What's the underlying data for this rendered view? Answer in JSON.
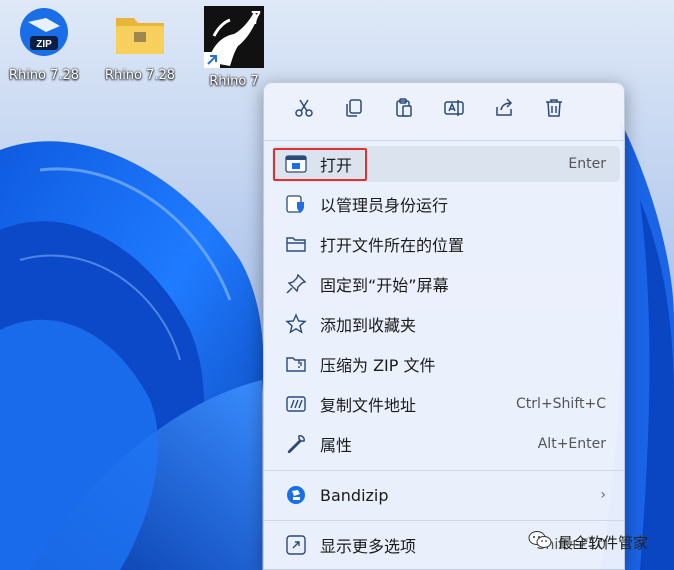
{
  "desktop": {
    "icons": [
      {
        "label": "Rhino 7.28",
        "icon": "zip-archive-icon"
      },
      {
        "label": "Rhino 7.28",
        "icon": "folder-icon"
      },
      {
        "label": "Rhino 7",
        "icon": "rhino-app-icon"
      }
    ]
  },
  "toolbar": {
    "items": [
      {
        "icon": "cut-icon"
      },
      {
        "icon": "copy-icon"
      },
      {
        "icon": "paste-icon"
      },
      {
        "icon": "rename-icon"
      },
      {
        "icon": "share-icon"
      },
      {
        "icon": "delete-icon"
      }
    ]
  },
  "menu": {
    "items": [
      {
        "label": "打开",
        "shortcut": "Enter",
        "icon": "open-window-icon"
      },
      {
        "label": "以管理员身份运行",
        "shortcut": "",
        "icon": "shield-icon"
      },
      {
        "label": "打开文件所在的位置",
        "shortcut": "",
        "icon": "folder-outline-icon"
      },
      {
        "label": "固定到“开始”屏幕",
        "shortcut": "",
        "icon": "pin-icon"
      },
      {
        "label": "添加到收藏夹",
        "shortcut": "",
        "icon": "star-icon"
      },
      {
        "label": "压缩为 ZIP 文件",
        "shortcut": "",
        "icon": "zip-folder-icon"
      },
      {
        "label": "复制文件地址",
        "shortcut": "Ctrl+Shift+C",
        "icon": "copy-path-icon"
      },
      {
        "label": "属性",
        "shortcut": "Alt+Enter",
        "icon": "wrench-icon"
      }
    ],
    "bandizip": {
      "label": "Bandizip",
      "icon": "bandizip-icon",
      "arrow": "›"
    },
    "more": {
      "label": "显示更多选项",
      "shortcut": "Shift+F10",
      "icon": "expand-icon"
    }
  },
  "watermark": {
    "text": "最全软件管家",
    "icon": "wechat-icon"
  },
  "colors": {
    "accent": "#0a56d6",
    "highlight_border": "#e03030",
    "menu_bg": "#ecf2fc"
  }
}
